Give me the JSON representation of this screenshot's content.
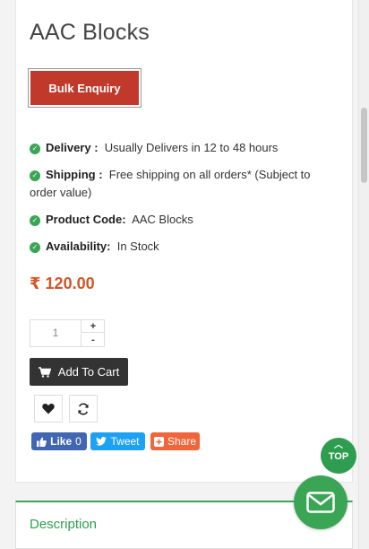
{
  "product": {
    "title": "AAC Blocks",
    "bulk_enquiry_label": "Bulk Enquiry",
    "details": [
      {
        "key": "Delivery :",
        "value": "Usually Delivers in 12 to 48 hours"
      },
      {
        "key": "Shipping :",
        "value": "Free shipping on all orders* (Subject to order value)"
      },
      {
        "key": "Product Code:",
        "value": "AAC Blocks"
      },
      {
        "key": "Availability:",
        "value": "In Stock"
      }
    ],
    "currency_symbol": "₹",
    "price": "120.00"
  },
  "quantity": {
    "value": "1",
    "plus": "+",
    "minus": "-"
  },
  "cart": {
    "add_label": "Add To Cart",
    "icon": "cart-icon"
  },
  "actions": {
    "wishlist_icon": "heart-icon",
    "compare_icon": "refresh-icon"
  },
  "social": {
    "like_label": "Like",
    "like_count": "0",
    "tweet_label": "Tweet",
    "share_label": "Share"
  },
  "floating": {
    "top_label": "TOP",
    "mail_icon": "envelope-icon"
  },
  "tabs": {
    "description_label": "Description"
  },
  "colors": {
    "accent": "#3aa655",
    "bulk_button": "#c0392b",
    "price": "#d35427",
    "facebook": "#4267b2",
    "twitter": "#1da1f2",
    "share": "#f0653a"
  }
}
